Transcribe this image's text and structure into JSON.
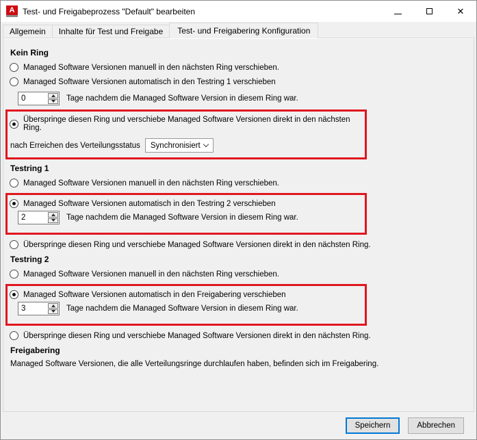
{
  "window": {
    "title": "Test- und Freigabeprozess \"Default\" bearbeiten",
    "controls": {
      "minimize": "minimize",
      "maximize": "maximize",
      "close": "close"
    }
  },
  "colors": {
    "highlight_red": "#e0161f",
    "primary_button_border": "#0078d7",
    "titlebar_bg": "#ffffff",
    "dialog_bg": "#f0f0f0",
    "app_icon_red": "#cf0a12"
  },
  "icons": {
    "app_logo_letter": "A",
    "close_glyph": "✕"
  },
  "tabs": [
    {
      "label": "Allgemein",
      "active": false
    },
    {
      "label": "Inhalte für Test und Freigabe",
      "active": false
    },
    {
      "label": "Test- und Freigabering Konfiguration",
      "active": true
    }
  ],
  "sections": {
    "kein_ring": {
      "heading": "Kein Ring",
      "opt_manual": "Managed Software Versionen manuell in den nächsten Ring verschieben.",
      "opt_auto": "Managed Software Versionen automatisch in den Testring 1 verschieben",
      "auto_days": "0",
      "auto_suffix": "Tage nachdem die Managed Software Version in diesem Ring war.",
      "opt_skip": "Überspringe diesen Ring und verschiebe Managed Software Versionen direkt in den nächsten Ring.",
      "status_label": "nach Erreichen des Verteilungsstatus",
      "status_value": "Synchronisiert"
    },
    "testring1": {
      "heading": "Testring 1",
      "opt_manual": "Managed Software Versionen manuell in den nächsten Ring verschieben.",
      "opt_auto": "Managed Software Versionen automatisch in den Testring 2 verschieben",
      "auto_days": "2",
      "auto_suffix": "Tage nachdem die Managed Software Version in diesem Ring war.",
      "opt_skip": "Überspringe diesen Ring und verschiebe Managed Software Versionen direkt in den nächsten Ring."
    },
    "testring2": {
      "heading": "Testring 2",
      "opt_manual": "Managed Software Versionen manuell in den nächsten Ring verschieben.",
      "opt_auto": "Managed Software Versionen automatisch in den Freigabering verschieben",
      "auto_days": "3",
      "auto_suffix": "Tage nachdem die Managed Software Version in diesem Ring war.",
      "opt_skip": "Überspringe diesen Ring und verschiebe Managed Software Versionen direkt in den nächsten Ring."
    },
    "freigabering": {
      "heading": "Freigabering",
      "description": "Managed Software Versionen, die alle Verteilungsringe durchlaufen haben, befinden sich im Freigabering."
    }
  },
  "footer": {
    "save_label": "Speichern",
    "cancel_label": "Abbrechen"
  }
}
